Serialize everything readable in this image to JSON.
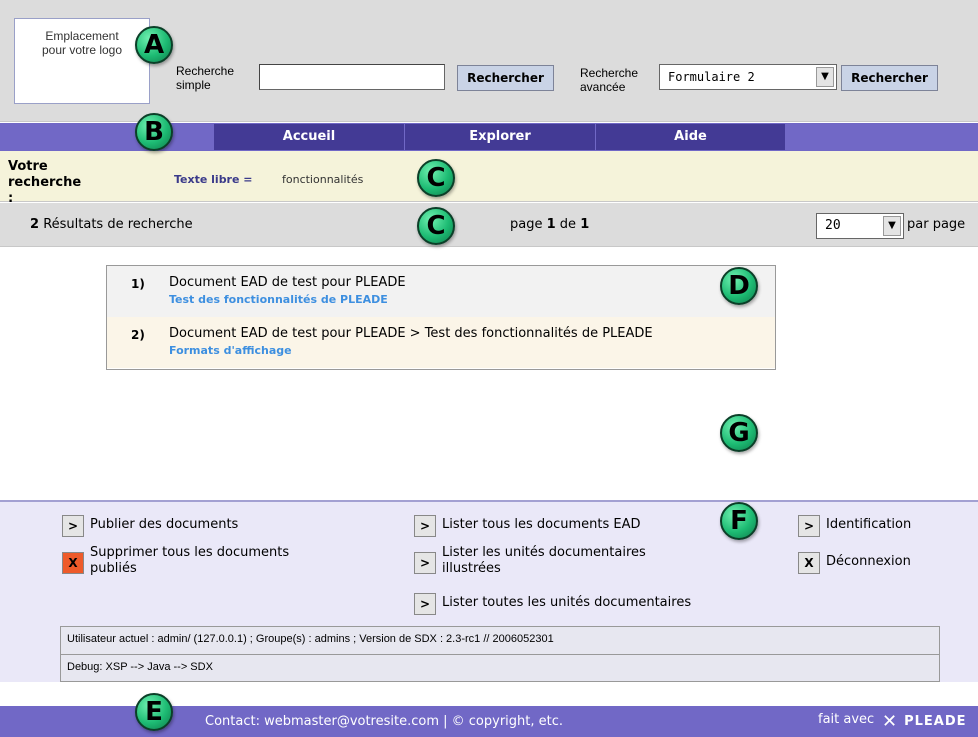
{
  "header": {
    "logo_placeholder_line1": "Emplacement",
    "logo_placeholder_line2": "pour votre logo",
    "simple_search_label_line1": "Recherche",
    "simple_search_label_line2": "simple",
    "simple_search_value": "",
    "simple_search_button": "Rechercher",
    "advanced_search_label_line1": "Recherche",
    "advanced_search_label_line2": "avancée",
    "advanced_form_selected": "Formulaire 2",
    "advanced_search_button": "Rechercher"
  },
  "nav": {
    "tabs": [
      {
        "label": "Accueil"
      },
      {
        "label": "Explorer"
      },
      {
        "label": "Aide"
      }
    ]
  },
  "query": {
    "label_line1": "Votre",
    "label_line2": "recherche :",
    "key": "Texte libre =",
    "value": "fonctionnalités"
  },
  "results_bar": {
    "count": "2",
    "count_label": "Résultats de recherche",
    "page_prefix": "page",
    "page_current": "1",
    "page_sep": "de",
    "page_total": "1",
    "per_page_value": "20",
    "per_page_label": "par page"
  },
  "results": [
    {
      "num": "1)",
      "title": "Document EAD de test pour PLEADE",
      "subtitle": "Test des fonctionnalités de PLEADE"
    },
    {
      "num": "2)",
      "title": "Document EAD de test pour PLEADE > Test des fonctionnalités de PLEADE",
      "subtitle": "Formats d'affichage"
    }
  ],
  "admin": {
    "col1": [
      {
        "btn": ">",
        "label": "Publier des documents"
      },
      {
        "btn": "X",
        "label_line1": "Supprimer tous les documents",
        "label_line2": "publiés"
      }
    ],
    "col2": [
      {
        "btn": ">",
        "label": "Lister tous les documents EAD"
      },
      {
        "btn": ">",
        "label_line1": "Lister les unités documentaires",
        "label_line2": "illustrées"
      },
      {
        "btn": ">",
        "label": "Lister toutes les unités documentaires"
      }
    ],
    "col3": [
      {
        "btn": ">",
        "label": "Identification"
      },
      {
        "btn": "X",
        "label": "Déconnexion"
      }
    ],
    "info_line1": "Utilisateur actuel : admin/ (127.0.0.1) ; Groupe(s) : admins ; Version de SDX : 2.3-rc1 // 2006052301",
    "info_line2": "Debug: XSP --> Java --> SDX"
  },
  "footer": {
    "contact": "Contact: webmaster@votresite.com | © copyright, etc.",
    "made_with": "fait avec",
    "brand": "PLEADE"
  },
  "markers": {
    "a": "A",
    "b": "B",
    "c1": "C",
    "c2": "C",
    "d": "D",
    "e": "E",
    "f": "F",
    "g": "G"
  },
  "colors": {
    "nav_bar": "#7168c6",
    "nav_tab": "#433a95",
    "query_bg": "#f5f3da",
    "link_blue": "#3d8fe0",
    "marker_green": "#1dbb73",
    "delete_red": "#ee5a2a"
  }
}
